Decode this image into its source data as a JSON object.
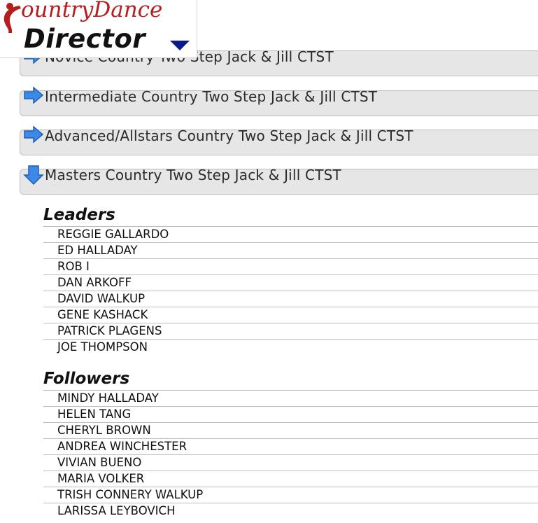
{
  "logo": {
    "top_text": "ountryDance",
    "bottom_text": "Director"
  },
  "accordion": [
    {
      "label": "Novice Country Two Step Jack & Jill CTST",
      "state": "collapsed"
    },
    {
      "label": "Intermediate Country Two Step Jack & Jill CTST",
      "state": "collapsed"
    },
    {
      "label": "Advanced/Allstars Country Two Step Jack & Jill CTST",
      "state": "collapsed"
    },
    {
      "label": "Masters Country Two Step Jack & Jill CTST",
      "state": "expanded"
    }
  ],
  "leaders": {
    "title": "Leaders",
    "names": [
      "REGGIE GALLARDO",
      "ED HALLADAY",
      "ROB I",
      "DAN ARKOFF",
      "DAVID WALKUP",
      "GENE KASHACK",
      "PATRICK PLAGENS",
      "JOE THOMPSON"
    ]
  },
  "followers": {
    "title": "Followers",
    "names": [
      "MINDY HALLADAY",
      "HELEN TANG",
      "CHERYL BROWN",
      "ANDREA WINCHESTER",
      "VIVIAN BUENO",
      "MARIA VOLKER",
      "TRISH CONNERY WALKUP",
      "LARISSA LEYBOVICH"
    ]
  },
  "colors": {
    "logo_red": "#b61e1e",
    "arrow_blue": "#2f7fe0",
    "caret_navy": "#0a1a8c",
    "header_bg": "#e6e6e6"
  }
}
